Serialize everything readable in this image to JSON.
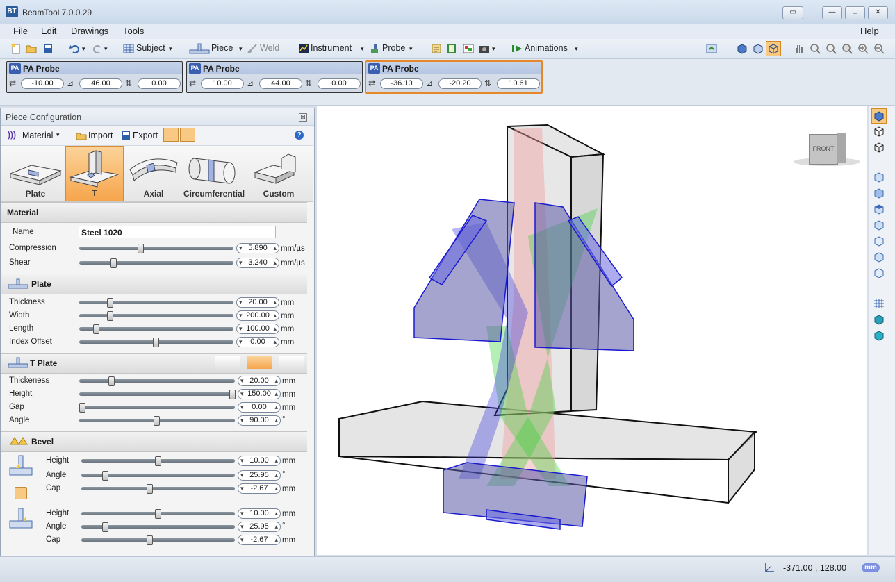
{
  "window": {
    "title": "BeamTool 7.0.0.29",
    "logo": "BT"
  },
  "menu": [
    "File",
    "Edit",
    "Drawings",
    "Tools"
  ],
  "menu_help": "Help",
  "toolbar": {
    "subject": "Subject",
    "piece": "Piece",
    "weld": "Weld",
    "instrument": "Instrument",
    "probe": "Probe",
    "animations": "Animations"
  },
  "probes": [
    {
      "badge": "PA",
      "title": "PA Probe",
      "v1": "-10.00",
      "v2": "46.00",
      "v3": "0.00"
    },
    {
      "badge": "PA",
      "title": "PA Probe",
      "v1": "10.00",
      "v2": "44.00",
      "v3": "0.00"
    },
    {
      "badge": "PA",
      "title": "PA Probe",
      "v1": "-36.10",
      "v2": "-20.20",
      "v3": "10.61"
    }
  ],
  "panel": {
    "title": "Piece Configuration",
    "close": "⊠",
    "material_btn": "Material",
    "import_btn": "Import",
    "export_btn": "Export",
    "piece_types": [
      "Plate",
      "T",
      "Axial",
      "Circumferential",
      "Custom"
    ],
    "material": {
      "section": "Material",
      "name_label": "Name",
      "name_value": "Steel 1020",
      "compression_label": "Compression",
      "compression": "5.890",
      "compression_unit": "mm/µs",
      "shear_label": "Shear",
      "shear": "3.240",
      "shear_unit": "mm/µs"
    },
    "plate": {
      "section": "Plate",
      "rows": [
        {
          "label": "Thickness",
          "value": "20.00",
          "unit": "mm"
        },
        {
          "label": "Width",
          "value": "200.00",
          "unit": "mm"
        },
        {
          "label": "Length",
          "value": "100.00",
          "unit": "mm"
        },
        {
          "label": "Index Offset",
          "value": "0.00",
          "unit": "mm"
        }
      ]
    },
    "tplate": {
      "section": "T Plate",
      "rows": [
        {
          "label": "Thickeness",
          "value": "20.00",
          "unit": "mm"
        },
        {
          "label": "Height",
          "value": "150.00",
          "unit": "mm"
        },
        {
          "label": "Gap",
          "value": "0.00",
          "unit": "mm"
        },
        {
          "label": "Angle",
          "value": "90.00",
          "unit": "°"
        }
      ]
    },
    "bevel": {
      "section": "Bevel",
      "rows": [
        {
          "label": "Height",
          "value": "10.00",
          "unit": "mm"
        },
        {
          "label": "Angle",
          "value": "25.95",
          "unit": "°"
        },
        {
          "label": "Cap",
          "value": "-2.67",
          "unit": "mm"
        },
        {
          "label": "Height",
          "value": "10.00",
          "unit": "mm"
        },
        {
          "label": "Angle",
          "value": "25.95",
          "unit": "°"
        },
        {
          "label": "Cap",
          "value": "-2.67",
          "unit": "mm"
        }
      ]
    }
  },
  "viewcube": {
    "label": "FRONT"
  },
  "status": {
    "coords": "-371.00 , 128.00",
    "unit_badge": "mm"
  }
}
